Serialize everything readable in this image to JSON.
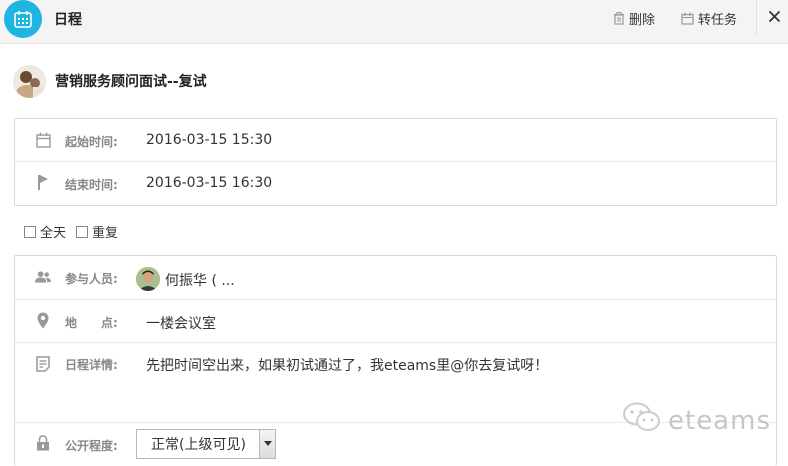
{
  "header": {
    "title": "日程",
    "delete_label": "删除",
    "convert_task_label": "转任务",
    "accent_color": "#1fb5e0"
  },
  "event": {
    "title": "营销服务顾问面试--复试"
  },
  "time": {
    "start_label": "起始时间:",
    "start_value": "2016-03-15 15:30",
    "end_label": "结束时间:",
    "end_value": "2016-03-15 16:30"
  },
  "options": {
    "all_day_label": "全天",
    "repeat_label": "重复",
    "all_day_checked": false,
    "repeat_checked": false
  },
  "details": {
    "participants_label": "参与人员:",
    "participants_value": "何振华 ( ...",
    "location_label": "地　　点:",
    "location_value": "一楼会议室",
    "description_label": "日程详情:",
    "description_value": "先把时间空出来，如果初试通过了，我eteams里@你去复试呀！",
    "visibility_label": "公开程度:",
    "visibility_value": "正常(上级可见)"
  },
  "watermark": {
    "text": "eteams"
  },
  "icons": {
    "app": "calendar-icon",
    "delete": "trash-icon",
    "convert": "calendar-small-icon",
    "close": "close-icon",
    "start": "calendar-outline-icon",
    "end": "flag-icon",
    "participants": "people-icon",
    "location": "map-pin-icon",
    "description": "document-icon",
    "visibility": "lock-icon",
    "dropdown": "chevron-down-icon"
  }
}
